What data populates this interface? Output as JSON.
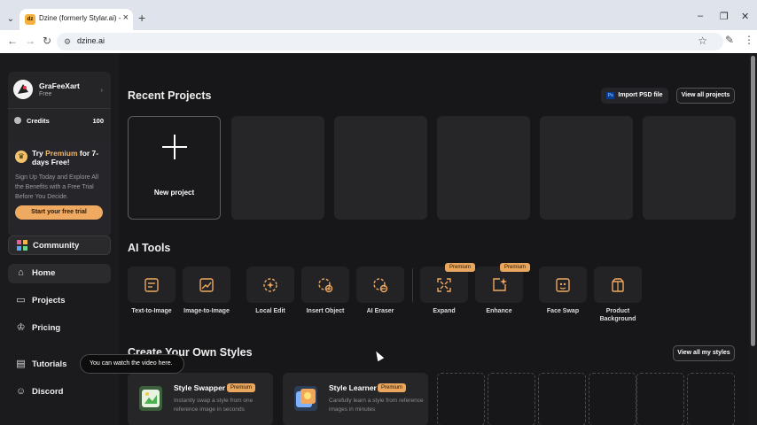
{
  "browser": {
    "tab_title": "Dzine (formerly Stylar.ai) - The",
    "tab_favicon_text": "dz",
    "url": "dzine.ai"
  },
  "sidebar": {
    "user_name": "GraFeeXart",
    "user_plan": "Free",
    "credits_label": "Credits",
    "credits_value": "100",
    "promo": {
      "title_prefix": "Try ",
      "title_highlight": "Premium",
      "title_suffix": " for 7-days Free!",
      "body": "Sign Up Today and Explore All the Benefits with a Free Trial Before You Decide.",
      "button": "Start your free trial"
    },
    "items": [
      {
        "label": "Community"
      },
      {
        "label": "Home"
      },
      {
        "label": "Projects"
      },
      {
        "label": "Pricing"
      },
      {
        "label": "Tutorials"
      },
      {
        "label": "Discord"
      }
    ],
    "tooltip": "You can watch the video here."
  },
  "recent": {
    "title": "Recent Projects",
    "import_button": "Import PSD file",
    "view_all_button": "View all projects",
    "new_project": "New project"
  },
  "tools": {
    "title": "AI Tools",
    "premium_badge": "Premium",
    "items": [
      {
        "label": "Text-to-Image"
      },
      {
        "label": "Image-to-Image"
      },
      {
        "label": "Local Edit"
      },
      {
        "label": "Insert Object"
      },
      {
        "label": "AI Eraser"
      },
      {
        "label": "Expand"
      },
      {
        "label": "Enhance"
      },
      {
        "label": "Face Swap"
      },
      {
        "label": "Product Background"
      }
    ]
  },
  "styles": {
    "title": "Create Your Own Styles",
    "view_all_button": "View all my styles",
    "cards": [
      {
        "name": "Style Swapper",
        "badge": "Premium",
        "desc": "Instantly swap a style from one reference image in seconds"
      },
      {
        "name": "Style Learner",
        "badge": "Premium",
        "desc": "Carefully learn a style from reference images in minutes"
      }
    ]
  },
  "colors": {
    "accent": "#f0a960",
    "background": "#171719",
    "sidebar": "#1b1b1d"
  }
}
